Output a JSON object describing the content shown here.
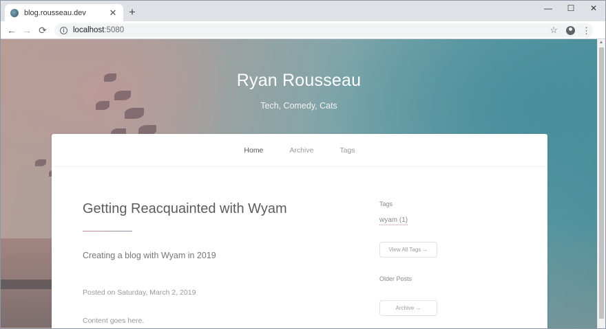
{
  "browser": {
    "tab_title": "blog.rousseau.dev",
    "tab_close": "✕",
    "new_tab": "+",
    "url_host": "localhost",
    "url_port": ":5080",
    "back": "←",
    "forward": "→",
    "reload": "⟳",
    "info": "i",
    "star": "☆",
    "menu": "⋮",
    "minimize": "—",
    "maximize": "☐",
    "close": "✕"
  },
  "header": {
    "title": "Ryan Rousseau",
    "subtitle": "Tech, Comedy, Cats"
  },
  "nav": {
    "items": [
      {
        "label": "Home",
        "active": true
      },
      {
        "label": "Archive",
        "active": false
      },
      {
        "label": "Tags",
        "active": false
      }
    ]
  },
  "post": {
    "title": "Getting Reacquainted with Wyam",
    "lead": "Creating a blog with Wyam in 2019",
    "meta": "Posted on Saturday, March 2, 2019",
    "body": "Content goes here."
  },
  "sidebar": {
    "tags_label": "Tags",
    "tag": "wyam (1)",
    "view_all_tags": "View All Tags →",
    "older_posts_label": "Older Posts",
    "archive_button": "Archive →"
  },
  "colors": {
    "accent": "#c98a9c",
    "hero_teal": "#4f919c",
    "hero_rose": "#b79d96"
  }
}
